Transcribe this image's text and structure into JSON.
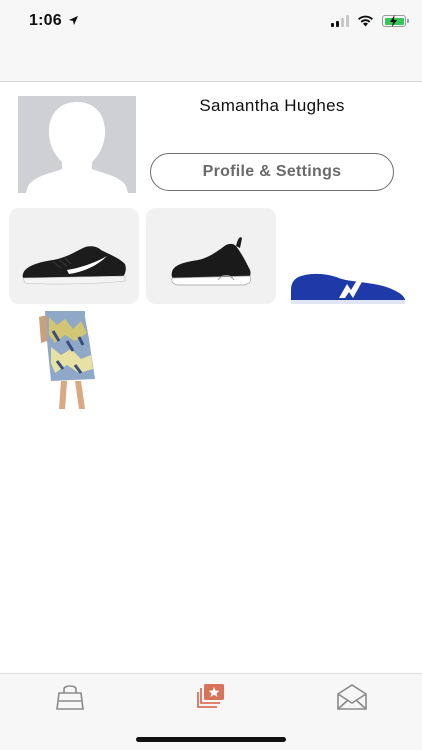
{
  "status_bar": {
    "time": "1:06"
  },
  "profile": {
    "name": "Samantha Hughes",
    "settings_button_label": "Profile & Settings"
  },
  "items": [
    {
      "icon": "black-white-running-shoe"
    },
    {
      "icon": "black-slip-on-sneaker"
    },
    {
      "icon": "blue-new-balance-sneaker"
    },
    {
      "icon": "floral-skirt-outfit"
    }
  ],
  "tab_bar": {
    "tabs": [
      {
        "icon": "shopping-bag-icon",
        "active": false
      },
      {
        "icon": "starred-cards-icon",
        "active": true
      },
      {
        "icon": "envelope-icon",
        "active": false
      }
    ]
  },
  "colors": {
    "accent": "#d9725a",
    "tab_inactive": "#8a8a8a",
    "button_border": "#6f6f6f"
  }
}
